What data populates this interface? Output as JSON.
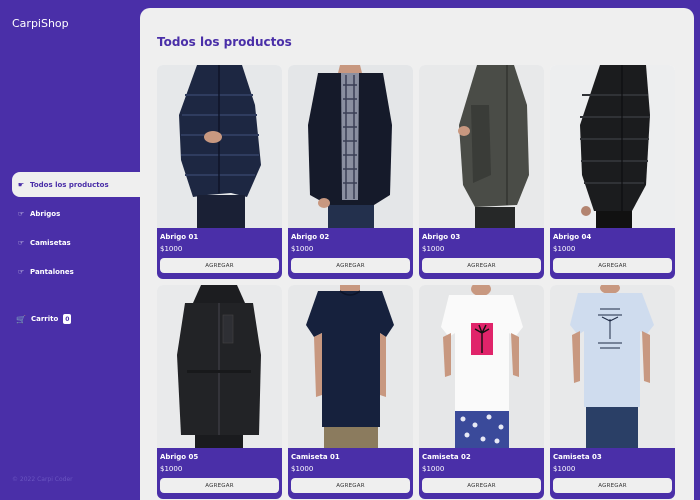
{
  "app": {
    "logo": "CarpiShop"
  },
  "sidebar": {
    "items": [
      {
        "label": "Todos los productos",
        "icon": "hand-pointer-icon",
        "active": true
      },
      {
        "label": "Abrigos",
        "icon": "hand-point-icon",
        "active": false
      },
      {
        "label": "Camisetas",
        "icon": "hand-point-icon",
        "active": false
      },
      {
        "label": "Pantalones",
        "icon": "hand-point-icon",
        "active": false
      }
    ],
    "cart": {
      "label": "Carrito",
      "count": "0",
      "icon": "cart-icon"
    },
    "footer": "© 2022 Carpi Coder"
  },
  "main": {
    "title": "Todos los productos",
    "products": [
      {
        "name": "Abrigo 01",
        "price": "$1000",
        "button": "AGREGAR"
      },
      {
        "name": "Abrigo 02",
        "price": "$1000",
        "button": "AGREGAR"
      },
      {
        "name": "Abrigo 03",
        "price": "$1000",
        "button": "AGREGAR"
      },
      {
        "name": "Abrigo 04",
        "price": "$1000",
        "button": "AGREGAR"
      },
      {
        "name": "Abrigo 05",
        "price": "$1000",
        "button": "AGREGAR"
      },
      {
        "name": "Camiseta 01",
        "price": "$1000",
        "button": "AGREGAR"
      },
      {
        "name": "Camiseta 02",
        "price": "$1000",
        "button": "AGREGAR"
      },
      {
        "name": "Camiseta 03",
        "price": "$1000",
        "button": "AGREGAR"
      }
    ]
  },
  "colors": {
    "accent": "#4a2fa8",
    "background": "#efefef"
  }
}
